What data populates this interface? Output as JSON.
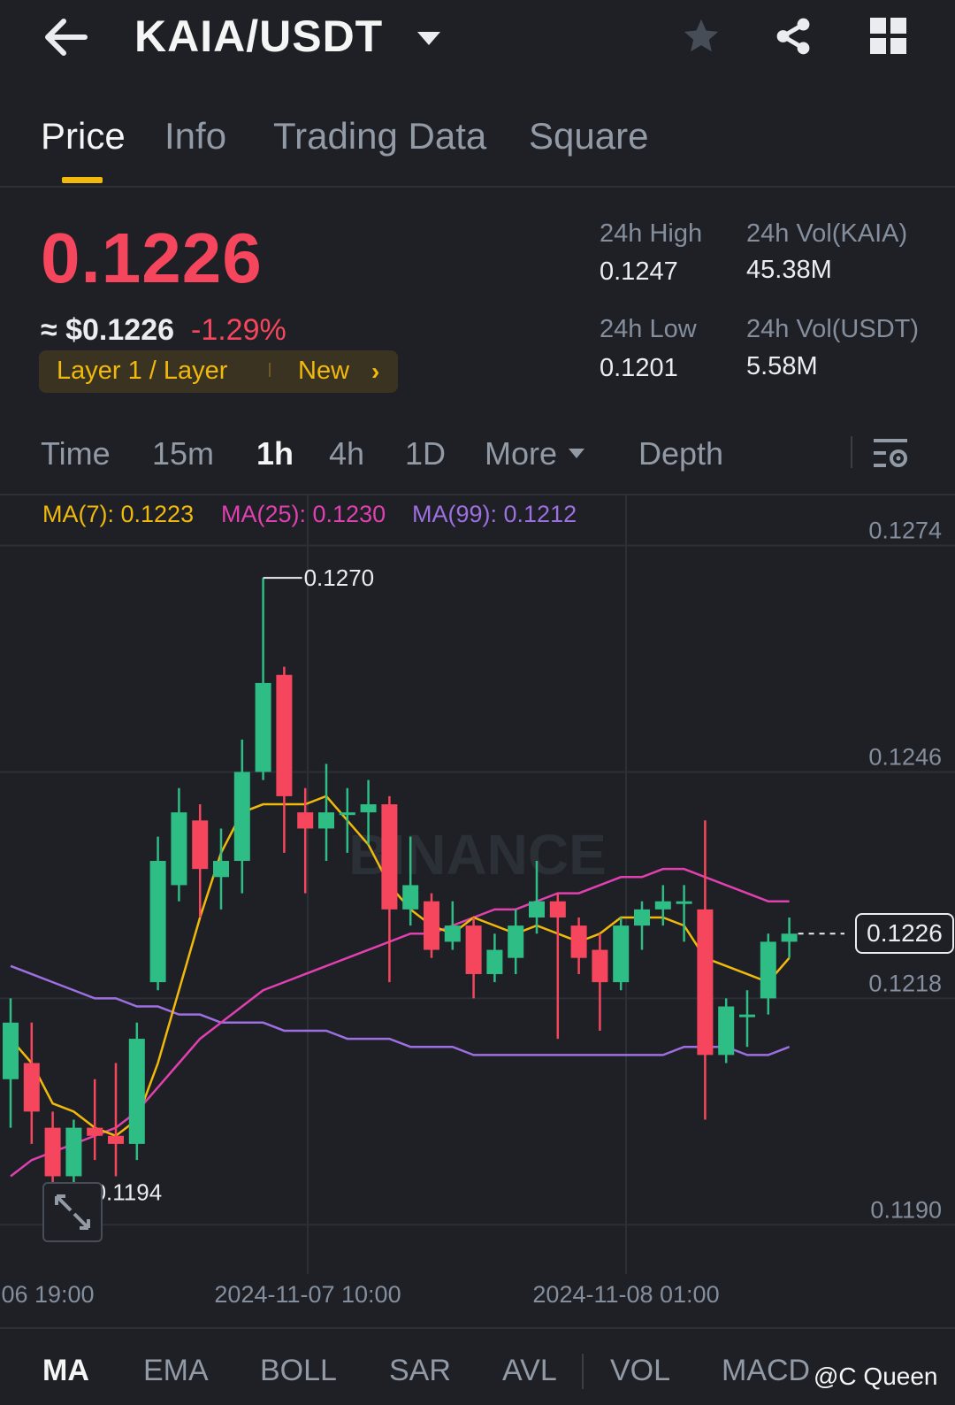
{
  "header": {
    "pair": "KAIA/USDT",
    "icons": [
      "back-arrow-icon",
      "dropdown-caret-icon",
      "star-icon",
      "share-icon",
      "grid-icon"
    ]
  },
  "tabs": [
    {
      "label": "Price",
      "active": true
    },
    {
      "label": "Info",
      "active": false
    },
    {
      "label": "Trading Data",
      "active": false
    },
    {
      "label": "Square",
      "active": false
    }
  ],
  "price": {
    "last": "0.1226",
    "fiat": "≈ $0.1226",
    "change": "-1.29%",
    "tag_category": "Layer 1 / Layer",
    "tag_new": "New"
  },
  "stats": {
    "high_label": "24h High",
    "high_value": "0.1247",
    "low_label": "24h Low",
    "low_value": "0.1201",
    "vol_base_label": "24h Vol(KAIA)",
    "vol_base_value": "45.38M",
    "vol_quote_label": "24h Vol(USDT)",
    "vol_quote_value": "5.58M"
  },
  "intervals": {
    "time": "Time",
    "m15": "15m",
    "h1": "1h",
    "h4": "4h",
    "d1": "1D",
    "more": "More",
    "depth": "Depth",
    "active": "1h"
  },
  "ma_legend": {
    "ma7": "MA(7): 0.1223",
    "ma25": "MA(25): 0.1230",
    "ma99": "MA(99): 0.1212"
  },
  "colors": {
    "up": "#2ebd85",
    "down": "#f6465d",
    "ma7": "#f0b90b",
    "ma25": "#e040b0",
    "ma99": "#9e6fe0",
    "accent": "#f0b90b"
  },
  "chart_data": {
    "type": "candlestick",
    "ylim": [
      0.1185,
      0.1278
    ],
    "y_ticks": [
      "0.1274",
      "0.1246",
      "0.1218",
      "0.1190"
    ],
    "x_labels": [
      "06 19:00",
      "2024-11-07 10:00",
      "2024-11-08 01:00"
    ],
    "last_price": "0.1226",
    "max_marker": "0.1270",
    "min_marker": "0.1194",
    "watermark": "BINANCE",
    "candles": [
      {
        "o": 0.1208,
        "c": 0.1215,
        "h": 0.1218,
        "l": 0.1202
      },
      {
        "o": 0.121,
        "c": 0.1204,
        "h": 0.1215,
        "l": 0.12
      },
      {
        "o": 0.1202,
        "c": 0.1196,
        "h": 0.1204,
        "l": 0.1194
      },
      {
        "o": 0.1196,
        "c": 0.1202,
        "h": 0.1203,
        "l": 0.1195
      },
      {
        "o": 0.1202,
        "c": 0.1201,
        "h": 0.1208,
        "l": 0.1198
      },
      {
        "o": 0.1201,
        "c": 0.12,
        "h": 0.121,
        "l": 0.1196
      },
      {
        "o": 0.12,
        "c": 0.1213,
        "h": 0.1215,
        "l": 0.1198
      },
      {
        "o": 0.122,
        "c": 0.1235,
        "h": 0.1238,
        "l": 0.1219
      },
      {
        "o": 0.1232,
        "c": 0.1241,
        "h": 0.1244,
        "l": 0.123
      },
      {
        "o": 0.124,
        "c": 0.1234,
        "h": 0.1242,
        "l": 0.1228
      },
      {
        "o": 0.1233,
        "c": 0.1235,
        "h": 0.1239,
        "l": 0.1229
      },
      {
        "o": 0.1235,
        "c": 0.1246,
        "h": 0.125,
        "l": 0.1231
      },
      {
        "o": 0.1246,
        "c": 0.1257,
        "h": 0.127,
        "l": 0.1245
      },
      {
        "o": 0.1258,
        "c": 0.1243,
        "h": 0.1259,
        "l": 0.1236
      },
      {
        "o": 0.1241,
        "c": 0.1239,
        "h": 0.1244,
        "l": 0.1231
      },
      {
        "o": 0.1239,
        "c": 0.1241,
        "h": 0.1247,
        "l": 0.1235
      },
      {
        "o": 0.1241,
        "c": 0.1241,
        "h": 0.1244,
        "l": 0.1236
      },
      {
        "o": 0.1241,
        "c": 0.1242,
        "h": 0.1245,
        "l": 0.1237
      },
      {
        "o": 0.1242,
        "c": 0.1229,
        "h": 0.1243,
        "l": 0.122
      },
      {
        "o": 0.1229,
        "c": 0.1232,
        "h": 0.1238,
        "l": 0.1227
      },
      {
        "o": 0.123,
        "c": 0.1224,
        "h": 0.1231,
        "l": 0.1223
      },
      {
        "o": 0.1225,
        "c": 0.1227,
        "h": 0.123,
        "l": 0.1224
      },
      {
        "o": 0.1227,
        "c": 0.1221,
        "h": 0.1228,
        "l": 0.1218
      },
      {
        "o": 0.1221,
        "c": 0.1224,
        "h": 0.1226,
        "l": 0.122
      },
      {
        "o": 0.1223,
        "c": 0.1227,
        "h": 0.1229,
        "l": 0.1221
      },
      {
        "o": 0.1228,
        "c": 0.123,
        "h": 0.1235,
        "l": 0.1226
      },
      {
        "o": 0.123,
        "c": 0.1228,
        "h": 0.1231,
        "l": 0.1213
      },
      {
        "o": 0.1227,
        "c": 0.1223,
        "h": 0.1228,
        "l": 0.1221
      },
      {
        "o": 0.1224,
        "c": 0.122,
        "h": 0.1226,
        "l": 0.1214
      },
      {
        "o": 0.122,
        "c": 0.1227,
        "h": 0.1228,
        "l": 0.1219
      },
      {
        "o": 0.1227,
        "c": 0.1229,
        "h": 0.123,
        "l": 0.1224
      },
      {
        "o": 0.1229,
        "c": 0.123,
        "h": 0.1232,
        "l": 0.1227
      },
      {
        "o": 0.123,
        "c": 0.123,
        "h": 0.1232,
        "l": 0.1225
      },
      {
        "o": 0.1229,
        "c": 0.1211,
        "h": 0.124,
        "l": 0.1203
      },
      {
        "o": 0.1211,
        "c": 0.1217,
        "h": 0.1218,
        "l": 0.121
      },
      {
        "o": 0.1216,
        "c": 0.1216,
        "h": 0.1219,
        "l": 0.1212
      },
      {
        "o": 0.1218,
        "c": 0.1225,
        "h": 0.1226,
        "l": 0.1216
      },
      {
        "o": 0.1225,
        "c": 0.1226,
        "h": 0.1228,
        "l": 0.1223
      }
    ],
    "ma7": [
      0.1213,
      0.121,
      0.1205,
      0.1204,
      0.1202,
      0.1201,
      0.1203,
      0.121,
      0.1219,
      0.1228,
      0.1236,
      0.1241,
      0.1242,
      0.1242,
      0.1242,
      0.1243,
      0.124,
      0.1237,
      0.1232,
      0.1229,
      0.1227,
      0.1226,
      0.1228,
      0.1227,
      0.1226,
      0.1227,
      0.1226,
      0.1225,
      0.1226,
      0.1228,
      0.1228,
      0.1228,
      0.1227,
      0.1223,
      0.1222,
      0.1221,
      0.122,
      0.1223
    ],
    "ma25": [
      0.1196,
      0.1198,
      0.1199,
      0.12,
      0.1201,
      0.1202,
      0.1204,
      0.1207,
      0.121,
      0.1213,
      0.1215,
      0.1217,
      0.1219,
      0.122,
      0.1221,
      0.1222,
      0.1223,
      0.1224,
      0.1225,
      0.1226,
      0.1226,
      0.1227,
      0.1228,
      0.1229,
      0.1229,
      0.123,
      0.1231,
      0.1231,
      0.1232,
      0.1233,
      0.1233,
      0.1234,
      0.1234,
      0.1233,
      0.1232,
      0.1231,
      0.123,
      0.123
    ],
    "ma99": [
      0.1222,
      0.1221,
      0.122,
      0.1219,
      0.1218,
      0.1218,
      0.1217,
      0.1217,
      0.1216,
      0.1216,
      0.1215,
      0.1215,
      0.1215,
      0.1214,
      0.1214,
      0.1214,
      0.1213,
      0.1213,
      0.1213,
      0.1212,
      0.1212,
      0.1212,
      0.1211,
      0.1211,
      0.1211,
      0.1211,
      0.1211,
      0.1211,
      0.1211,
      0.1211,
      0.1211,
      0.1211,
      0.1212,
      0.1212,
      0.1212,
      0.1211,
      0.1211,
      0.1212
    ]
  },
  "indicators": [
    "MA",
    "EMA",
    "BOLL",
    "SAR",
    "AVL",
    "VOL",
    "MACD"
  ],
  "watermark_user": "@C Queen"
}
